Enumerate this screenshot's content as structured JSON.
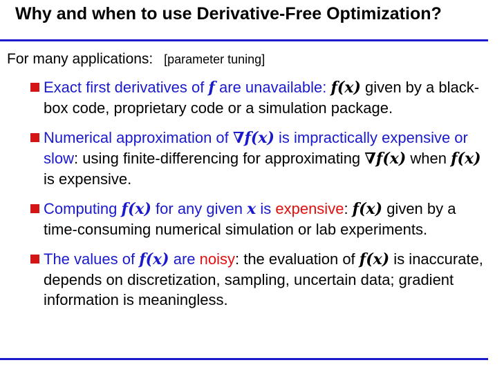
{
  "title": "Why and when to use Derivative-Free Optimization?",
  "intro": {
    "text": "For many applications:",
    "tag": "[parameter tuning]"
  },
  "items": [
    {
      "parts": [
        {
          "t": "Exact first derivatives of ",
          "c": "blue"
        },
        {
          "t": "f",
          "c": "blue",
          "m": true
        },
        {
          "t": " are unavailable: ",
          "c": "blue"
        },
        {
          "t": "f(x)",
          "c": "black",
          "m": true
        },
        {
          "t": " given by a black-box code, proprietary code or a simulation package.",
          "c": "black"
        }
      ]
    },
    {
      "parts": [
        {
          "t": "Numerical approximation of ",
          "c": "blue"
        },
        {
          "t": "∇f(x)",
          "c": "blue",
          "m": true
        },
        {
          "t": " is impractically expensive or slow",
          "c": "blue"
        },
        {
          "t": ": using finite-differencing for approximating ",
          "c": "black"
        },
        {
          "t": "∇f(x)",
          "c": "black",
          "m": true
        },
        {
          "t": " when ",
          "c": "black"
        },
        {
          "t": "f(x)",
          "c": "black",
          "m": true
        },
        {
          "t": " is expensive.",
          "c": "black"
        }
      ]
    },
    {
      "parts": [
        {
          "t": "Computing ",
          "c": "blue"
        },
        {
          "t": "f(x)",
          "c": "blue",
          "m": true
        },
        {
          "t": " for any given ",
          "c": "blue"
        },
        {
          "t": "x",
          "c": "blue",
          "m": true
        },
        {
          "t": " is ",
          "c": "blue"
        },
        {
          "t": "expensive",
          "c": "red"
        },
        {
          "t": ": ",
          "c": "black"
        },
        {
          "t": "f(x)",
          "c": "black",
          "m": true
        },
        {
          "t": " given by a time-consuming numerical simulation or lab experiments.",
          "c": "black"
        }
      ]
    },
    {
      "parts": [
        {
          "t": "The values of ",
          "c": "blue"
        },
        {
          "t": "f(x)",
          "c": "blue",
          "m": true
        },
        {
          "t": " are ",
          "c": "blue"
        },
        {
          "t": "noisy",
          "c": "red"
        },
        {
          "t": ": the evaluation of ",
          "c": "black"
        },
        {
          "t": "f(x)",
          "c": "black",
          "m": true
        },
        {
          "t": " is inaccurate, depends on discretization, sampling, uncertain data; gradient information is meaningless.",
          "c": "black"
        }
      ]
    }
  ],
  "colors": {
    "accent_blue": "#1a1acc",
    "highlight_red": "#e01010",
    "bullet_red": "#d31515"
  }
}
